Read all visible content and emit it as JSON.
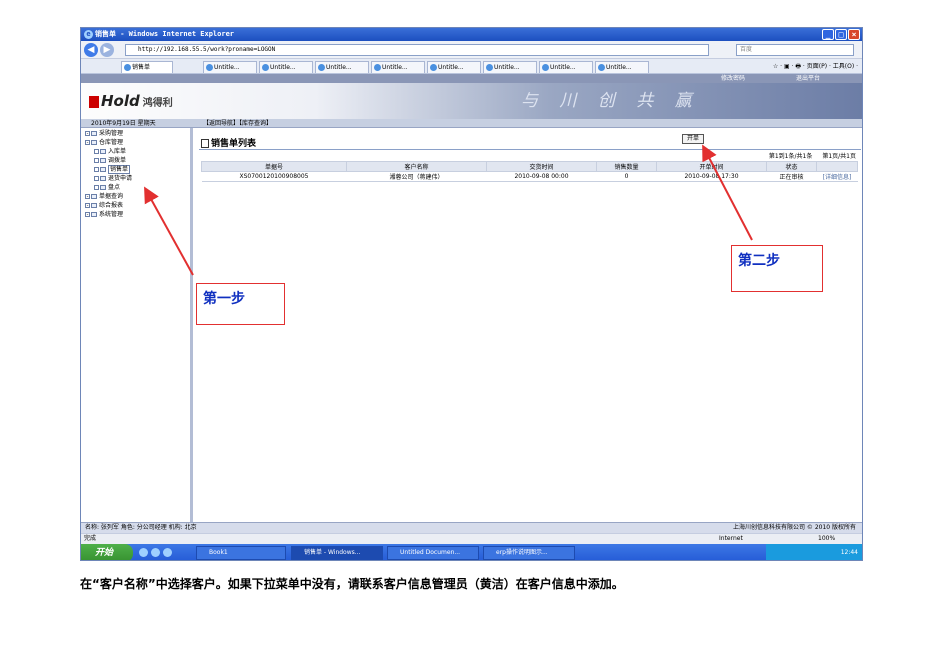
{
  "window": {
    "title": "销售单 - Windows Internet Explorer"
  },
  "browser": {
    "address": "http://192.168.55.5/work?proname=LOGON",
    "search_placeholder": "百度",
    "tabs": [
      "销售单",
      "Untitle...",
      "Untitle...",
      "Untitle...",
      "Untitle...",
      "Untitle...",
      "Untitle...",
      "Untitle...",
      "Untitle..."
    ],
    "tools": "☆ · ▣ · 🖶 · 页面(P) · 工具(O) ·"
  },
  "banner": {
    "top_links": [
      "修改密码",
      "退出平台"
    ],
    "logo_text": "Hold",
    "logo_cn": "鸿得利",
    "slogan": "与 川 创 共 赢"
  },
  "nav": {
    "date": "2010年9月19日 星期天",
    "links": "【返回导航】【库存查询】"
  },
  "sidebar": {
    "items": [
      {
        "label": "采购管理",
        "level": 0
      },
      {
        "label": "仓库管理",
        "level": 0
      },
      {
        "label": "入库单",
        "level": 1
      },
      {
        "label": "调拨单",
        "level": 1
      },
      {
        "label": "销售单",
        "level": 1
      },
      {
        "label": "退货申请",
        "level": 1
      },
      {
        "label": "盘点",
        "level": 1
      },
      {
        "label": "单据查询",
        "level": 0
      },
      {
        "label": "综合报表",
        "level": 0
      },
      {
        "label": "系统管理",
        "level": 0
      }
    ]
  },
  "main": {
    "title": "销售单列表",
    "new_button": "开单",
    "pager": {
      "count": "第1到1条/共1条",
      "pages": "第1页/共1页"
    },
    "columns": [
      "单据号",
      "客户名称",
      "交货时间",
      "销售数量",
      "开单时间",
      "状态",
      ""
    ],
    "rows": [
      [
        "XS0700120100908005",
        "湘蓉公司（蒋建伟）",
        "2010-09-08 00:00",
        "0",
        "2010-09-08 17:30",
        "正在审核",
        "[详细信息]"
      ]
    ]
  },
  "status": {
    "user_info": "名称: 张列军  角色: 分公司经理  机构: 北京",
    "copyright": "上海川创信息科技有限公司 © 2010 版权所有",
    "done": "完成",
    "zone": "Internet",
    "zoom": "100%"
  },
  "taskbar": {
    "start": "开始",
    "buttons": [
      "Book1",
      "销售单 - Windows...",
      "Untitled Documen...",
      "erp操作说明图示..."
    ],
    "clock": "12:44"
  },
  "annotations": {
    "step1": "第一步",
    "step2": "第二步"
  },
  "caption": "在“客户名称”中选择客户。如果下拉菜单中没有，请联系客户信息管理员（黄洁）在客户信息中添加。",
  "colors": {
    "annotation_border": "#e23030",
    "annotation_text": "#1030c0",
    "titlebar": "#1c4fbf"
  }
}
